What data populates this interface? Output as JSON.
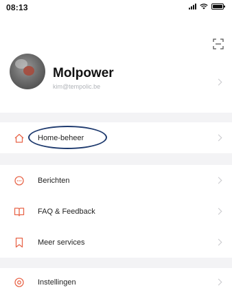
{
  "status_bar": {
    "time": "08:13"
  },
  "profile": {
    "name": "Molpower",
    "email": "kim@tempolic.be"
  },
  "menu": {
    "home_management": "Home-beheer",
    "messages": "Berichten",
    "faq_feedback": "FAQ & Feedback",
    "more_services": "Meer services",
    "settings": "Instellingen"
  },
  "colors": {
    "accent": "#e8664a",
    "annotation": "#1e3a6e",
    "background": "#f3f3f5",
    "card": "#ffffff"
  },
  "icons": {
    "scan": "scan-icon",
    "home": "home-icon",
    "messages": "message-icon",
    "faq": "book-icon",
    "services": "bookmark-icon",
    "settings": "settings-icon"
  }
}
